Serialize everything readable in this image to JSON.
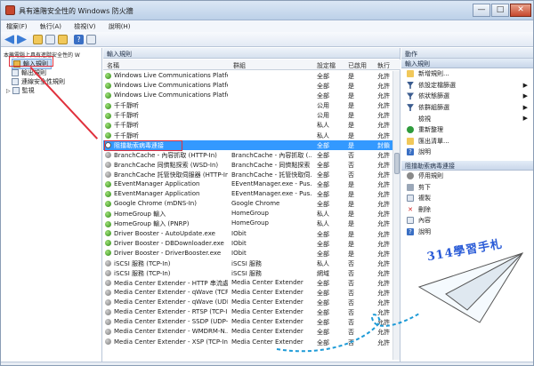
{
  "window": {
    "title": "具有進階安全性的 Windows 防火牆"
  },
  "title_buttons": {
    "minimize": "—",
    "maximize": "□",
    "close": "✕"
  },
  "menu": [
    "檔案(F)",
    "執行(A)",
    "檢視(V)",
    "說明(H)"
  ],
  "tree": {
    "root": "本機電腦上具有進階安全性的 W",
    "items": [
      {
        "label": "輸入規則",
        "icon": "inbound-rules-icon"
      },
      {
        "label": "輸出規則",
        "icon": "outbound-rules-icon"
      },
      {
        "label": "連線安全性規則",
        "icon": "connection-security-icon"
      },
      {
        "label": "監視",
        "icon": "monitor-icon"
      }
    ]
  },
  "main": {
    "header": "輸入規則",
    "columns": [
      "名稱",
      "群組",
      "設定檔",
      "已啟用",
      "執行"
    ],
    "rows": [
      {
        "name": "Windows Live Communications Platform",
        "group": "",
        "profile": "全部",
        "enabled": "是",
        "action": "允許",
        "icon": "allow"
      },
      {
        "name": "Windows Live Communications Platform",
        "group": "",
        "profile": "全部",
        "enabled": "是",
        "action": "允許",
        "icon": "allow"
      },
      {
        "name": "Windows Live Communications Platform",
        "group": "",
        "profile": "全部",
        "enabled": "是",
        "action": "允許",
        "icon": "allow"
      },
      {
        "name": "千千靜听",
        "group": "",
        "profile": "公用",
        "enabled": "是",
        "action": "允許",
        "icon": "allow"
      },
      {
        "name": "千千靜听",
        "group": "",
        "profile": "公用",
        "enabled": "是",
        "action": "允許",
        "icon": "allow"
      },
      {
        "name": "千千靜听",
        "group": "",
        "profile": "私人",
        "enabled": "是",
        "action": "允許",
        "icon": "allow"
      },
      {
        "name": "千千靜听",
        "group": "",
        "profile": "私人",
        "enabled": "是",
        "action": "允許",
        "icon": "allow"
      },
      {
        "name": "阻擋勒索病毒連接",
        "group": "",
        "profile": "全部",
        "enabled": "是",
        "action": "封鎖",
        "icon": "block",
        "selected": true
      },
      {
        "name": "BranchCache - 內容抓取 (HTTP-In)",
        "group": "BranchCache - 內容抓取 (...",
        "profile": "全部",
        "enabled": "否",
        "action": "允許",
        "icon": "disabled"
      },
      {
        "name": "BranchCache 同儕點探索 (WSD-In)",
        "group": "BranchCache - 同儕點探索 (...",
        "profile": "全部",
        "enabled": "否",
        "action": "允許",
        "icon": "disabled"
      },
      {
        "name": "BranchCache 託管快取伺服器 (HTTP-In)",
        "group": "BranchCache - 託管快取伺...",
        "profile": "全部",
        "enabled": "否",
        "action": "允許",
        "icon": "disabled"
      },
      {
        "name": "EEventManager Application",
        "group": "EEventManager.exe - Pus...",
        "profile": "全部",
        "enabled": "是",
        "action": "允許",
        "icon": "allow"
      },
      {
        "name": "EEventManager Application",
        "group": "EEventManager.exe - Pus...",
        "profile": "全部",
        "enabled": "是",
        "action": "允許",
        "icon": "allow"
      },
      {
        "name": "Google Chrome (mDNS-In)",
        "group": "Google Chrome",
        "profile": "全部",
        "enabled": "是",
        "action": "允許",
        "icon": "allow"
      },
      {
        "name": "HomeGroup 輸入",
        "group": "HomeGroup",
        "profile": "私人",
        "enabled": "是",
        "action": "允許",
        "icon": "allow"
      },
      {
        "name": "HomeGroup 輸入 (PNRP)",
        "group": "HomeGroup",
        "profile": "私人",
        "enabled": "是",
        "action": "允許",
        "icon": "allow"
      },
      {
        "name": "Driver Booster - AutoUpdate.exe",
        "group": "IObit",
        "profile": "全部",
        "enabled": "是",
        "action": "允許",
        "icon": "allow"
      },
      {
        "name": "Driver Booster - DBDownloader.exe",
        "group": "IObit",
        "profile": "全部",
        "enabled": "是",
        "action": "允許",
        "icon": "allow"
      },
      {
        "name": "Driver Booster - DriverBooster.exe",
        "group": "IObit",
        "profile": "全部",
        "enabled": "是",
        "action": "允許",
        "icon": "allow"
      },
      {
        "name": "iSCSI 服務 (TCP-In)",
        "group": "iSCSI 服務",
        "profile": "私人",
        "enabled": "否",
        "action": "允許",
        "icon": "disabled"
      },
      {
        "name": "iSCSI 服務 (TCP-In)",
        "group": "iSCSI 服務",
        "profile": "網域",
        "enabled": "否",
        "action": "允許",
        "icon": "disabled"
      },
      {
        "name": "Media Center Extender - HTTP 串流處...",
        "group": "Media Center Extender",
        "profile": "全部",
        "enabled": "否",
        "action": "允許",
        "icon": "disabled"
      },
      {
        "name": "Media Center Extender - qWave (TCP-...",
        "group": "Media Center Extender",
        "profile": "全部",
        "enabled": "否",
        "action": "允許",
        "icon": "disabled"
      },
      {
        "name": "Media Center Extender - qWave (UDP...",
        "group": "Media Center Extender",
        "profile": "全部",
        "enabled": "否",
        "action": "允許",
        "icon": "disabled"
      },
      {
        "name": "Media Center Extender - RTSP (TCP-In)",
        "group": "Media Center Extender",
        "profile": "全部",
        "enabled": "否",
        "action": "允許",
        "icon": "disabled"
      },
      {
        "name": "Media Center Extender - SSDP (UDP-In)",
        "group": "Media Center Extender",
        "profile": "全部",
        "enabled": "否",
        "action": "允許",
        "icon": "disabled"
      },
      {
        "name": "Media Center Extender - WMDRM-N...",
        "group": "Media Center Extender",
        "profile": "全部",
        "enabled": "否",
        "action": "允許",
        "icon": "disabled"
      },
      {
        "name": "Media Center Extender - XSP (TCP-In)",
        "group": "Media Center Extender",
        "profile": "全部",
        "enabled": "否",
        "action": "允許",
        "icon": "disabled"
      }
    ]
  },
  "actions": {
    "header": "動作",
    "section1": {
      "title": "輸入規則",
      "items": [
        {
          "label": "新增規則...",
          "icon": "new-rule-icon",
          "arrow": false
        },
        {
          "label": "依設定檔篩選",
          "icon": "filter-icon",
          "arrow": true
        },
        {
          "label": "依狀態篩選",
          "icon": "filter-icon",
          "arrow": true
        },
        {
          "label": "依群組篩選",
          "icon": "filter-icon",
          "arrow": true
        },
        {
          "label": "檢視",
          "icon": "",
          "arrow": true
        },
        {
          "label": "重新整理",
          "icon": "refresh-icon",
          "arrow": false
        },
        {
          "label": "匯出清單...",
          "icon": "export-icon",
          "arrow": false
        },
        {
          "label": "說明",
          "icon": "help-icon",
          "arrow": false
        }
      ]
    },
    "section2": {
      "title": "阻擋勒索病毒連接",
      "items": [
        {
          "label": "停用規則",
          "icon": "disable-rule-icon"
        },
        {
          "label": "剪下",
          "icon": "cut-icon"
        },
        {
          "label": "複製",
          "icon": "copy-icon"
        },
        {
          "label": "刪除",
          "icon": "delete-icon"
        },
        {
          "label": "內容",
          "icon": "properties-icon"
        },
        {
          "label": "說明",
          "icon": "help-icon"
        }
      ]
    }
  },
  "watermark": "314學習手札",
  "colors": {
    "highlight": "#3399ff",
    "annotation": "#e0303c",
    "allow": "#2d8a15",
    "watermark": "#2a5bd7"
  }
}
